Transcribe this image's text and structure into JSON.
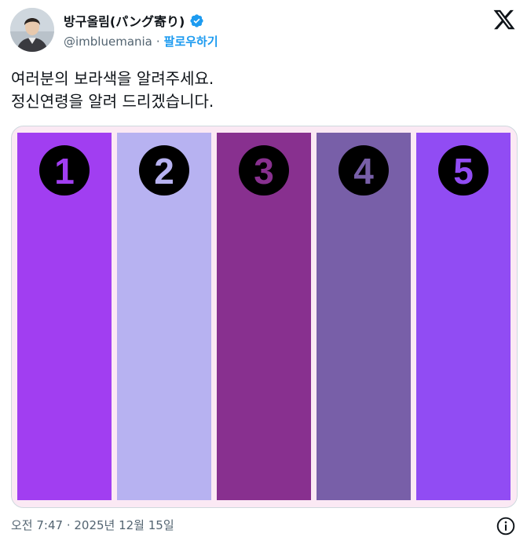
{
  "author": {
    "display_name": "방구올림(パング寄り)",
    "handle": "@imbluemania",
    "separator": "·",
    "follow_label": "팔로우하기"
  },
  "icons": {
    "verified": "verified-badge-icon",
    "logo": "x-logo-icon",
    "info": "info-icon"
  },
  "tweet": {
    "line1": "여러분의 보라색을 알려주세요.",
    "line2": "정신연령을 알려 드리겠습니다."
  },
  "image": {
    "background": "#fbe9f4",
    "bars": [
      {
        "number": "1",
        "color": "#a13ef1"
      },
      {
        "number": "2",
        "color": "#b7b2f1"
      },
      {
        "number": "3",
        "color": "#88308f"
      },
      {
        "number": "4",
        "color": "#785fa8"
      },
      {
        "number": "5",
        "color": "#914cf3"
      }
    ]
  },
  "footer": {
    "timestamp": "오전 7:47 · 2025년 12월 15일"
  },
  "colors": {
    "link": "#1d9bf0",
    "secondary_text": "#536471",
    "verified": "#1d9bf0"
  }
}
